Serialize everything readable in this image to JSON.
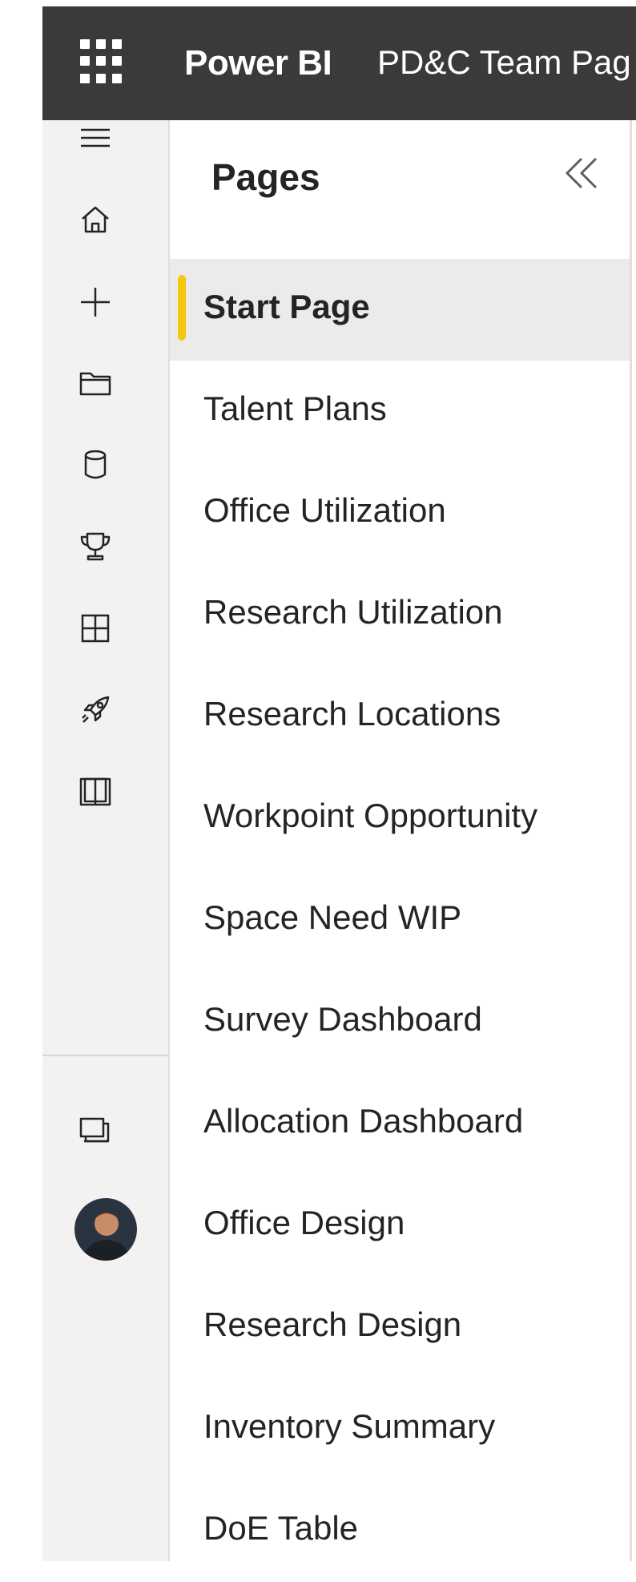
{
  "topbar": {
    "app_title": "Power BI",
    "report_title": "PD&C Team Pag"
  },
  "leftnav": {
    "icons": [
      "hamburger-menu-icon",
      "home-icon",
      "create-plus-icon",
      "browse-folder-icon",
      "datahub-cylinder-icon",
      "goals-trophy-icon",
      "apps-icon",
      "deployment-rocket-icon",
      "learn-book-icon",
      "workspaces-icon"
    ]
  },
  "pages_panel": {
    "header": "Pages",
    "items": [
      {
        "label": "Start Page",
        "active": true
      },
      {
        "label": "Talent Plans"
      },
      {
        "label": "Office Utilization"
      },
      {
        "label": "Research Utilization"
      },
      {
        "label": "Research Locations"
      },
      {
        "label": "Workpoint Opportunity"
      },
      {
        "label": "Space Need WIP"
      },
      {
        "label": "Survey Dashboard"
      },
      {
        "label": "Allocation Dashboard"
      },
      {
        "label": "Office Design"
      },
      {
        "label": "Research Design"
      },
      {
        "label": "Inventory Summary"
      },
      {
        "label": "DoE Table"
      }
    ]
  },
  "colors": {
    "topbar": "#3b3a39",
    "nav_bg": "#f3f2f1",
    "active_bg": "#edebe9",
    "active_marker": "#f2c811"
  }
}
